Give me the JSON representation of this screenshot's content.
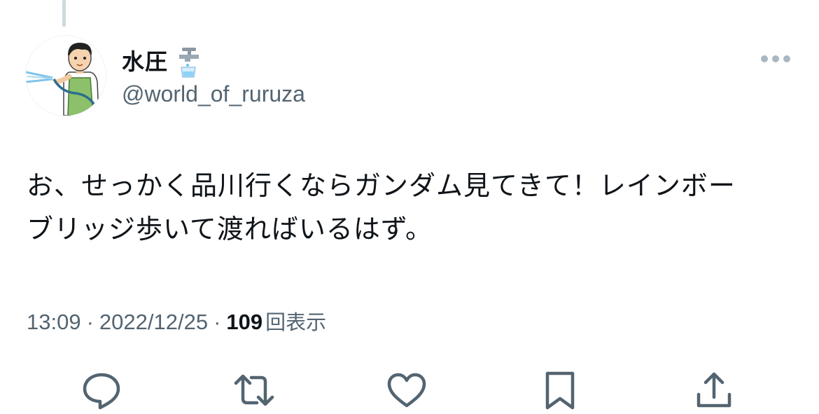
{
  "tweet": {
    "author": {
      "display_name": "水圧",
      "handle": "@world_of_ruruza",
      "avatar_icon": "boy-watering-hose-avatar",
      "name_emoji_icon": "faucet-icon"
    },
    "text_lines": [
      "お、せっかく品川行くならガンダム見てきて！レインボー",
      "ブリッジ歩いて渡ればいるはず。"
    ],
    "meta": {
      "time": "13:09",
      "separator": "·",
      "date": "2022/12/25",
      "views_count": "109",
      "views_label": "回表示"
    },
    "actions": [
      {
        "name": "reply",
        "icon": "reply-icon"
      },
      {
        "name": "retweet",
        "icon": "retweet-icon"
      },
      {
        "name": "like",
        "icon": "heart-icon"
      },
      {
        "name": "bookmark",
        "icon": "bookmark-icon"
      },
      {
        "name": "share",
        "icon": "share-icon"
      }
    ],
    "more_icon": "more-options-icon"
  },
  "colors": {
    "text_primary": "#0f1419",
    "text_secondary": "#536471",
    "icon_gray": "#536471",
    "thread_line": "#cfd9de"
  }
}
